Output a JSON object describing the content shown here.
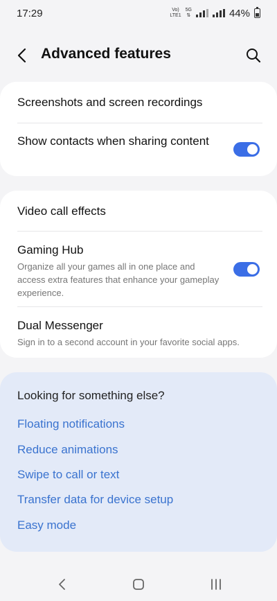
{
  "status": {
    "time": "17:29",
    "volte_top": "Vo)",
    "volte_bottom": "LTE1",
    "net_5g": "5G",
    "battery": "44%"
  },
  "header": {
    "title": "Advanced features"
  },
  "group1": {
    "screenshots": "Screenshots and screen recordings",
    "show_contacts": "Show contacts when sharing content",
    "show_contacts_on": true
  },
  "group2": {
    "video_call": "Video call effects",
    "gaming_hub": "Gaming Hub",
    "gaming_hub_desc": "Organize all your games all in one place and access extra features that enhance your gameplay experience.",
    "gaming_hub_on": true,
    "dual_messenger": "Dual Messenger",
    "dual_messenger_desc": "Sign in to a second account in your favorite social apps."
  },
  "suggestions": {
    "title": "Looking for something else?",
    "links": [
      "Floating notifications",
      "Reduce animations",
      "Swipe to call or text",
      "Transfer data for device setup",
      "Easy mode"
    ]
  },
  "colors": {
    "accent": "#3b6ee6",
    "link": "#3a73cf",
    "background": "#f4f4f6",
    "suggest_bg": "#e3eaf8"
  }
}
